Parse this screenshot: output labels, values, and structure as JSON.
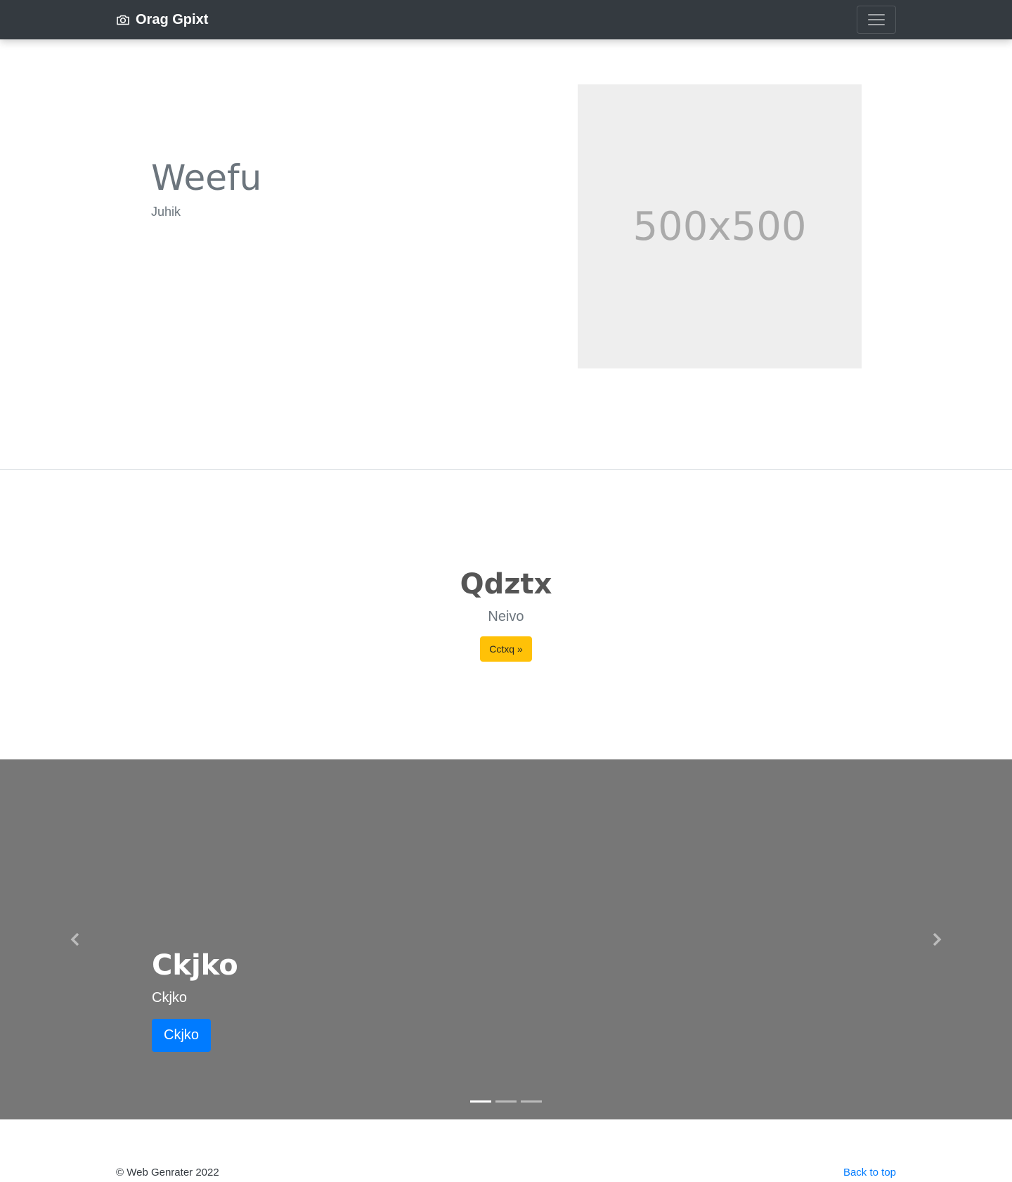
{
  "navbar": {
    "brand": "Orag Gpixt",
    "brand_icon": "camera-icon",
    "toggler_icon": "hamburger-icon",
    "background": "#343a40"
  },
  "hero": {
    "title": "Weefu",
    "subtitle": "Juhik",
    "image_placeholder": "500x500"
  },
  "callout": {
    "title": "Qdztx",
    "subtitle": "Neivo",
    "button_label": "Cctxq »",
    "button_color": "#ffc107"
  },
  "carousel": {
    "background": "#777777",
    "prev_icon": "chevron-left-icon",
    "next_icon": "chevron-right-icon",
    "active_index": 0,
    "slide_count": 3,
    "caption": {
      "title": "Ckjko",
      "subtitle": "Ckjko",
      "button_label": "Ckjko",
      "button_color": "#007bff"
    }
  },
  "footer": {
    "copyright": "© Web Genrater 2022",
    "back_to_top": "Back to top"
  }
}
